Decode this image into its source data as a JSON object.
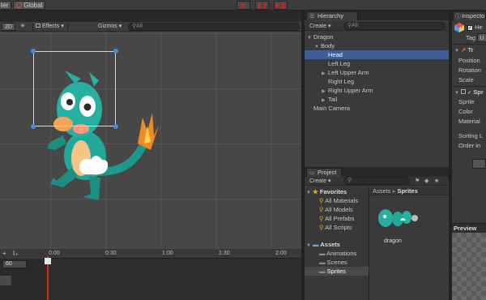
{
  "toolbar": {
    "left_label": "ter",
    "global_label": "Global"
  },
  "scene": {
    "mode_2d": "2D",
    "effects": "Effects",
    "gizmos": "Gizmos",
    "search": "All"
  },
  "timeline": {
    "frame": "60",
    "ticks": [
      "0:00",
      "0:30",
      "1:00",
      "1:30",
      "2:00"
    ]
  },
  "hierarchy": {
    "tab": "Hierarchy",
    "create": "Create",
    "search": "All",
    "items": [
      {
        "label": "Dragon",
        "indent": 0,
        "arrow": "▼",
        "selected": false
      },
      {
        "label": "Body",
        "indent": 1,
        "arrow": "▼",
        "selected": false
      },
      {
        "label": "Head",
        "indent": 2,
        "arrow": "",
        "selected": true
      },
      {
        "label": "Left Leg",
        "indent": 2,
        "arrow": "",
        "selected": false
      },
      {
        "label": "Left Upper Arm",
        "indent": 2,
        "arrow": "▶",
        "selected": false
      },
      {
        "label": "Right Leg",
        "indent": 2,
        "arrow": "",
        "selected": false
      },
      {
        "label": "Right Upper Arm",
        "indent": 2,
        "arrow": "▶",
        "selected": false
      },
      {
        "label": "Tail",
        "indent": 2,
        "arrow": "▶",
        "selected": false
      },
      {
        "label": "Main Camera",
        "indent": 0,
        "arrow": "",
        "selected": false
      }
    ]
  },
  "project": {
    "tab": "Project",
    "create": "Create",
    "favorites_label": "Favorites",
    "favorites": [
      "All Materials",
      "All Models",
      "All Prefabs",
      "All Scripts"
    ],
    "assets_label": "Assets",
    "folders": [
      "Animations",
      "Scenes",
      "Sprites"
    ],
    "breadcrumb_root": "Assets",
    "breadcrumb_sep": "▸",
    "breadcrumb_current": "Sprites",
    "asset_name": "dragon"
  },
  "inspector": {
    "tab": "Inspecto",
    "name_field": "He",
    "tag_label": "Tag",
    "tag_value": "U",
    "transform": "Tr",
    "position": "Position",
    "rotation": "Rotation",
    "scale": "Scale",
    "sprite_comp": "Spr",
    "sprite": "Sprite",
    "color": "Color",
    "material": "Material",
    "sorting": "Sorting L",
    "order": "Order in",
    "preview": "Preview"
  },
  "colors": {
    "selection": "#3e5f96",
    "play_red": "#d02020",
    "folder_blue": "#7ea6cc",
    "favorite_yellow": "#e0b020",
    "playhead": "#e02525"
  }
}
